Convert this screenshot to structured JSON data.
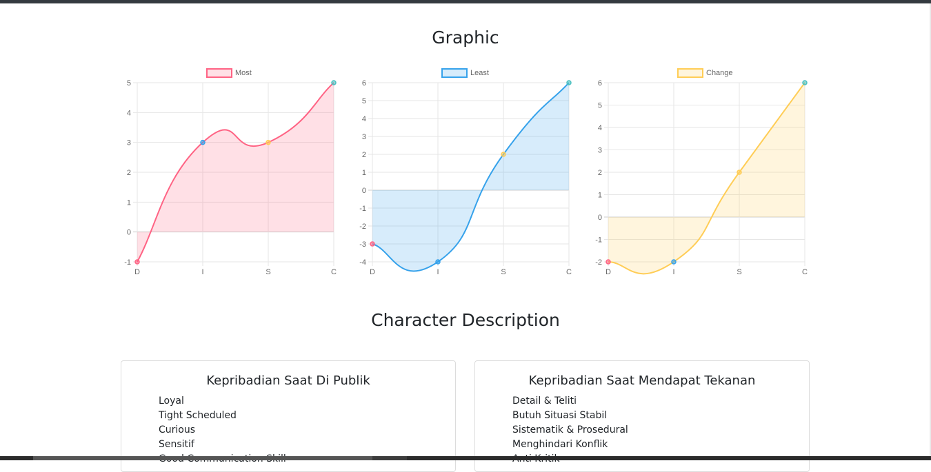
{
  "headings": {
    "graphic": "Graphic",
    "character_description": "Character Description"
  },
  "colors": {
    "most": "#ff6384",
    "least": "#36a2eb",
    "change": "#ffcd56",
    "teal_point": "#4bc0c0"
  },
  "chart_data": [
    {
      "type": "line",
      "fill": "area-to-zero",
      "categories": [
        "D",
        "I",
        "S",
        "C"
      ],
      "series": [
        {
          "name": "Most",
          "values": [
            -1,
            3,
            3,
            5
          ]
        }
      ],
      "ylim": [
        -1,
        5
      ],
      "yticks": [
        -1,
        0,
        1,
        2,
        3,
        4,
        5
      ],
      "legend": "top-center",
      "grid": true,
      "title": "",
      "xlabel": "",
      "ylabel": ""
    },
    {
      "type": "line",
      "fill": "area-to-zero",
      "categories": [
        "D",
        "I",
        "S",
        "C"
      ],
      "series": [
        {
          "name": "Least",
          "values": [
            -3,
            -4,
            2,
            6
          ]
        }
      ],
      "ylim": [
        -4,
        6
      ],
      "yticks": [
        -4,
        -3,
        -2,
        -1,
        0,
        1,
        2,
        3,
        4,
        5,
        6
      ],
      "legend": "top-center",
      "grid": true,
      "title": "",
      "xlabel": "",
      "ylabel": ""
    },
    {
      "type": "line",
      "fill": "area-to-zero",
      "categories": [
        "D",
        "I",
        "S",
        "C"
      ],
      "series": [
        {
          "name": "Change",
          "values": [
            -2,
            -2,
            2,
            6
          ]
        }
      ],
      "ylim": [
        -2,
        6
      ],
      "yticks": [
        -2,
        -1,
        0,
        1,
        2,
        3,
        4,
        5,
        6
      ],
      "legend": "top-center",
      "grid": true,
      "title": "",
      "xlabel": "",
      "ylabel": ""
    }
  ],
  "cards": [
    {
      "title": "Kepribadian Saat Di Publik",
      "items": [
        "Loyal",
        "Tight Scheduled",
        "Curious",
        "Sensitif",
        "Good Communication Skill"
      ]
    },
    {
      "title": "Kepribadian Saat Mendapat Tekanan",
      "items": [
        "Detail & Teliti",
        "Butuh Situasi Stabil",
        "Sistematik & Prosedural",
        "Menghindari Konflik",
        "Anti Kritik"
      ]
    }
  ]
}
